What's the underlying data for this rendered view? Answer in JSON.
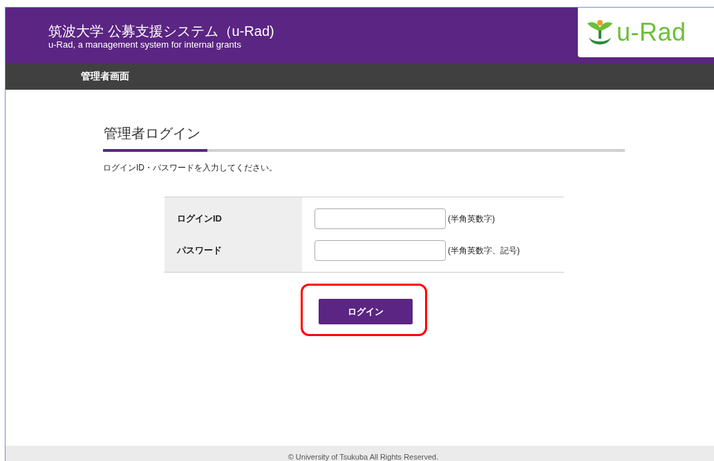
{
  "header": {
    "title": "筑波大学 公募支援システム（u-Rad)",
    "subtitle": "u-Rad, a management system for internal grants",
    "logo_text": "u-Rad"
  },
  "nav_bar": {
    "label": "管理者画面"
  },
  "section": {
    "heading": "管理者ログイン",
    "instruction": "ログインID・パスワードを入力してください。"
  },
  "form": {
    "rows": [
      {
        "label": "ログインID",
        "hint": "(半角英数字)"
      },
      {
        "label": "パスワード",
        "hint": "(半角英数字、記号)"
      }
    ],
    "submit": "ログイン",
    "highlighted": true
  },
  "footer": {
    "text": "© University of Tsukuba All Rights Reserved."
  }
}
